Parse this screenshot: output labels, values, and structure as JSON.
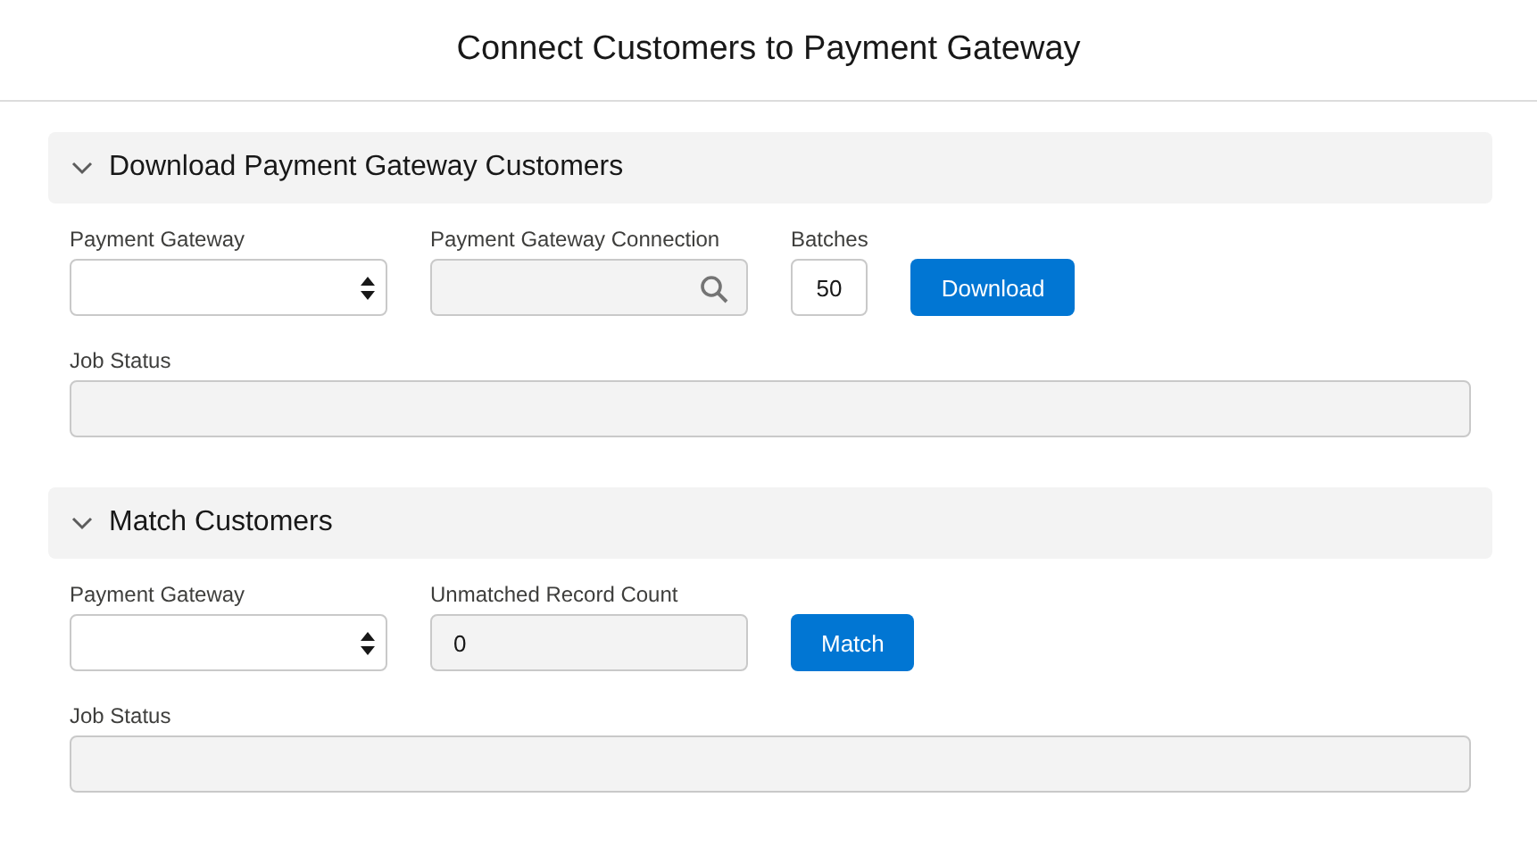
{
  "page": {
    "title": "Connect Customers to Payment Gateway"
  },
  "sections": [
    {
      "title": "Download Payment Gateway Customers",
      "expanded": true,
      "fields": [
        {
          "kind": "select",
          "label": "Payment Gateway",
          "disabled": false
        },
        {
          "kind": "lookup",
          "label": "Payment Gateway Connection",
          "disabled": true
        },
        {
          "kind": "number",
          "label": "Batches",
          "value": "50",
          "disabled": false
        },
        {
          "kind": "button",
          "label": "Download"
        }
      ],
      "status": {
        "label": "Job Status",
        "disabled": true
      }
    },
    {
      "title": "Match Customers",
      "expanded": true,
      "fields": [
        {
          "kind": "select",
          "label": "Payment Gateway",
          "disabled": false
        },
        {
          "kind": "count",
          "label": "Unmatched Record Count",
          "value": "0",
          "disabled": true
        },
        {
          "kind": "button",
          "label": "Match"
        }
      ],
      "status": {
        "label": "Job Status",
        "disabled": true
      }
    }
  ]
}
